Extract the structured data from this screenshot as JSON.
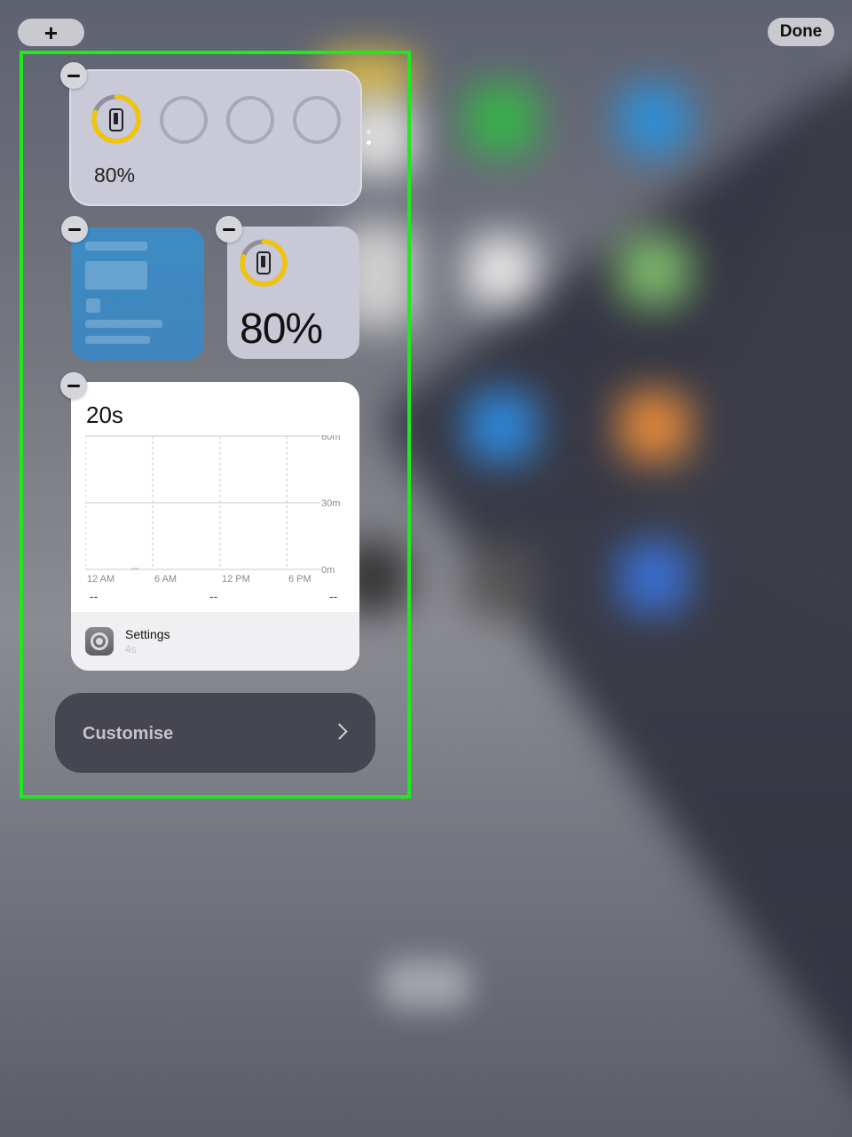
{
  "toolbar": {
    "add_label": "+",
    "done_label": "Done"
  },
  "battery_large": {
    "percent_label": "80%",
    "device_level": 0.8,
    "ring_color": "#f5c400"
  },
  "battery_small": {
    "percent_label": "80%",
    "device_level": 0.8
  },
  "screen_time": {
    "total": "20s",
    "y_ticks": [
      "60m",
      "30m",
      "0m"
    ],
    "x_ticks": [
      "12 AM",
      "6 AM",
      "12 PM",
      "6 PM"
    ],
    "summary": [
      "--",
      "--",
      "--"
    ],
    "top_app": {
      "name": "Settings",
      "time": "4s",
      "icon": "settings-gear-icon"
    }
  },
  "customise": {
    "label": "Customise",
    "icon": "chevron-right-icon"
  },
  "colors": {
    "highlight": "#1ee81e",
    "ring": "#f5c400",
    "notes_blue": "#3e8bc4"
  }
}
